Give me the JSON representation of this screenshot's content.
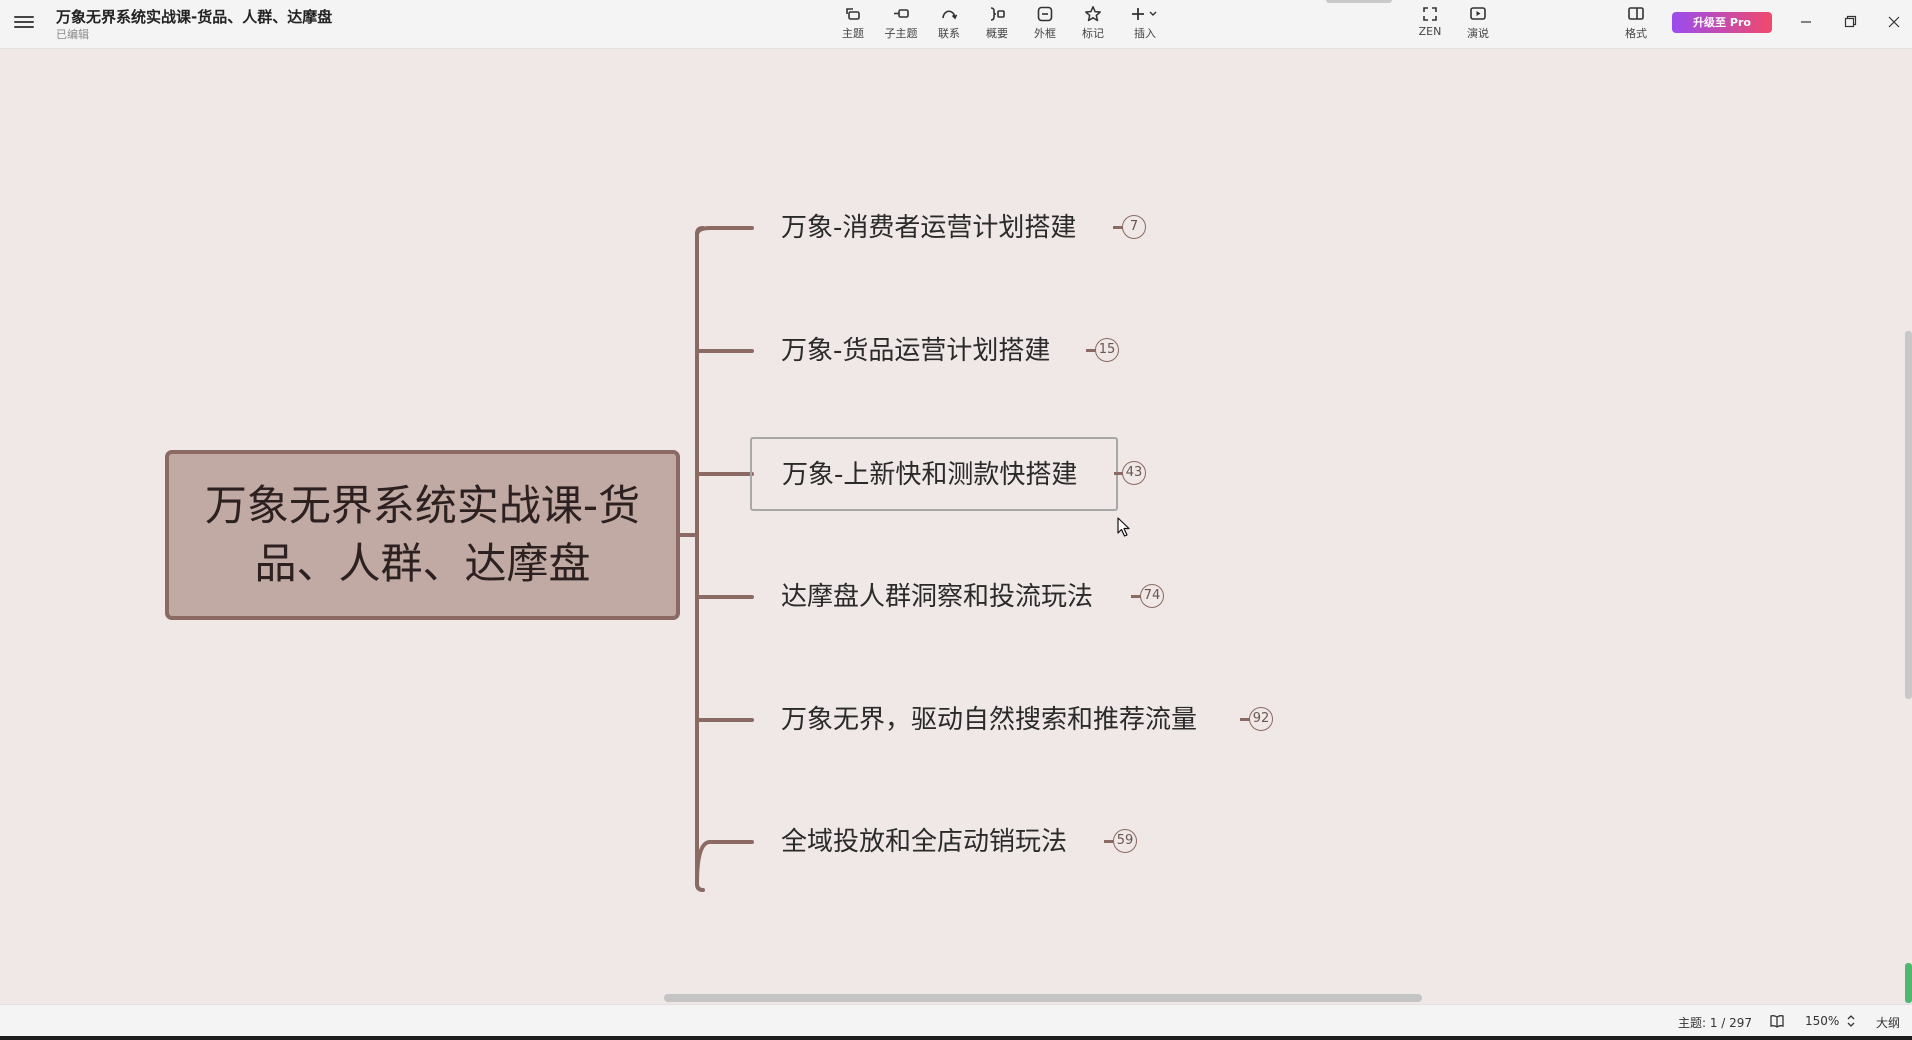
{
  "app": {
    "title": "万象无界系统实战课-货品、人群、达摩盘",
    "status": "已编辑"
  },
  "toolbar": {
    "items": [
      {
        "label": "主题",
        "icon": "topic-icon"
      },
      {
        "label": "子主题",
        "icon": "subtopic-icon"
      },
      {
        "label": "联系",
        "icon": "relationship-icon"
      },
      {
        "label": "概要",
        "icon": "summary-icon"
      },
      {
        "label": "外框",
        "icon": "boundary-icon"
      },
      {
        "label": "标记",
        "icon": "star-icon"
      },
      {
        "label": "插入",
        "icon": "plus-icon"
      }
    ],
    "zen_label": "ZEN",
    "present_label": "演说",
    "format_label": "格式",
    "pro_label": "升级至 Pro"
  },
  "mindmap": {
    "root": "万象无界系统实战课-货品、人群、达摩盘",
    "topics": [
      {
        "label": "万象-消费者运营计划搭建",
        "count": "7"
      },
      {
        "label": "万象-货品运营计划搭建",
        "count": "15"
      },
      {
        "label": "万象-上新快和测款快搭建",
        "count": "43",
        "selected": true
      },
      {
        "label": "达摩盘人群洞察和投流玩法",
        "count": "74"
      },
      {
        "label": "万象无界，驱动自然搜索和推荐流量",
        "count": "92"
      },
      {
        "label": "全域投放和全店动销玩法",
        "count": "59"
      }
    ],
    "colors": {
      "branch": "#8a6a62",
      "root_fill": "#c1aaa3",
      "background": "#efe8e6"
    }
  },
  "statusbar": {
    "topic_count": "主题: 1 / 297",
    "zoom": "150%",
    "outline_label": "大纲"
  }
}
